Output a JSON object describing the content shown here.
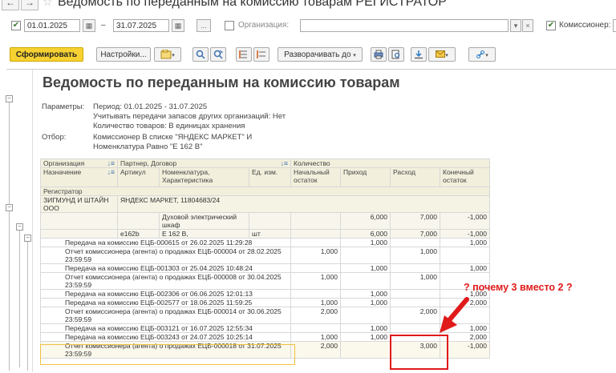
{
  "window": {
    "back": "←",
    "forward": "→",
    "star": "☆",
    "title": "Ведомость по переданным на комиссию товарам РЕГИСТРАТОР"
  },
  "filters": {
    "period_checked": "✔",
    "date_from": "01.01.2025",
    "dash": "–",
    "date_to": "31.07.2025",
    "ellipsis": "...",
    "org_label": "Организация:",
    "org_value": "",
    "commissioner_checked": "✔",
    "commissioner_label": "Комиссионер:",
    "cal_icon": "▦",
    "dropdown": "▾",
    "clear": "×"
  },
  "commands": {
    "generate": "Сформировать",
    "settings": "Настройки...",
    "expand_to": "Разворачивать до"
  },
  "report": {
    "title": "Ведомость по переданным на комиссию товарам",
    "params_label": "Параметры:",
    "params": [
      "Период: 01.01.2025 - 31.07.2025",
      "Учитывать передачи запасов других организаций: Нет",
      "Количество товаров: В единицах хранения"
    ],
    "filter_label": "Отбор:",
    "filters": [
      "Комиссионер В списке \"ЯНДЕКС МАРКЕТ\" И",
      "Номенклатура Равно \"Е 162 В\""
    ]
  },
  "table": {
    "h1": {
      "org": "Организация",
      "partner": "Партнер, Договор",
      "qty": "Количество"
    },
    "h2": {
      "purpose": "Назначение",
      "article": "Артикул",
      "nomen": "Номенклатура, Характеристика",
      "unit": "Ед. изм.",
      "start": "Начальный остаток",
      "in": "Приход",
      "out": "Расход",
      "end": "Конечный остаток"
    },
    "h3": "Регистратор",
    "org_row": {
      "org": "ЗИГМУНД И ШТАЙН ООО",
      "partner": "ЯНДЕКС МАРКЕТ, 11804683/24"
    },
    "cat_row": {
      "nomen": "Духовой электрический шкаф",
      "in": "6,000",
      "out": "7,000",
      "end": "-1,000"
    },
    "item_row": {
      "article": "e162b",
      "nomen": "E 162 B,",
      "unit": "шт",
      "in": "6,000",
      "out": "7,000",
      "end": "-1,000"
    },
    "docs": [
      {
        "doc": "Передача на комиссию ЕЦБ-000615 от 26.02.2025 11:29:28",
        "start": "",
        "in": "1,000",
        "out": "",
        "end": "1,000"
      },
      {
        "doc": "Отчет комиссионера (агента) о продажах ЕЦБ-000004 от 28.02.2025",
        "doc2": "23:59:59",
        "start": "1,000",
        "in": "",
        "out": "1,000",
        "end": ""
      },
      {
        "doc": "Передача на комиссию ЕЦБ-001303 от 25.04.2025 10:48:24",
        "start": "",
        "in": "1,000",
        "out": "",
        "end": "1,000"
      },
      {
        "doc": "Отчет комиссионера (агента) о продажах ЕЦБ-000008 от 30.04.2025",
        "doc2": "23:59:59",
        "start": "1,000",
        "in": "",
        "out": "1,000",
        "end": ""
      },
      {
        "doc": "Передача на комиссию ЕЦБ-002306 от 06.06.2025 12:01:13",
        "start": "",
        "in": "1,000",
        "out": "",
        "end": "1,000"
      },
      {
        "doc": "Передача на комиссию ЕЦБ-002577 от 18.06.2025 11:59:25",
        "start": "1,000",
        "in": "1,000",
        "out": "",
        "end": "2,000"
      },
      {
        "doc": "Отчет комиссионера (агента) о продажах ЕЦБ-000014 от 30.06.2025",
        "doc2": "23:59:59",
        "start": "2,000",
        "in": "",
        "out": "2,000",
        "end": ""
      },
      {
        "doc": "Передача на комиссию ЕЦБ-003121 от 16.07.2025 12:55:34",
        "start": "",
        "in": "1,000",
        "out": "",
        "end": "1,000"
      },
      {
        "doc": "Передача на комиссию ЕЦБ-003243 от 24.07.2025 10:25:14",
        "start": "1,000",
        "in": "1,000",
        "out": "",
        "end": "2,000"
      },
      {
        "doc": "Отчет комиссионера (агента) о продажах ЕЦБ-000018 от 31.07.2025",
        "doc2": "23:59:59",
        "start": "2,000",
        "in": "",
        "out": "3,000",
        "end": "-1,000"
      }
    ]
  },
  "annotation": {
    "text": "? почему 3 вместо 2 ?",
    "color": "#e01a1a"
  }
}
